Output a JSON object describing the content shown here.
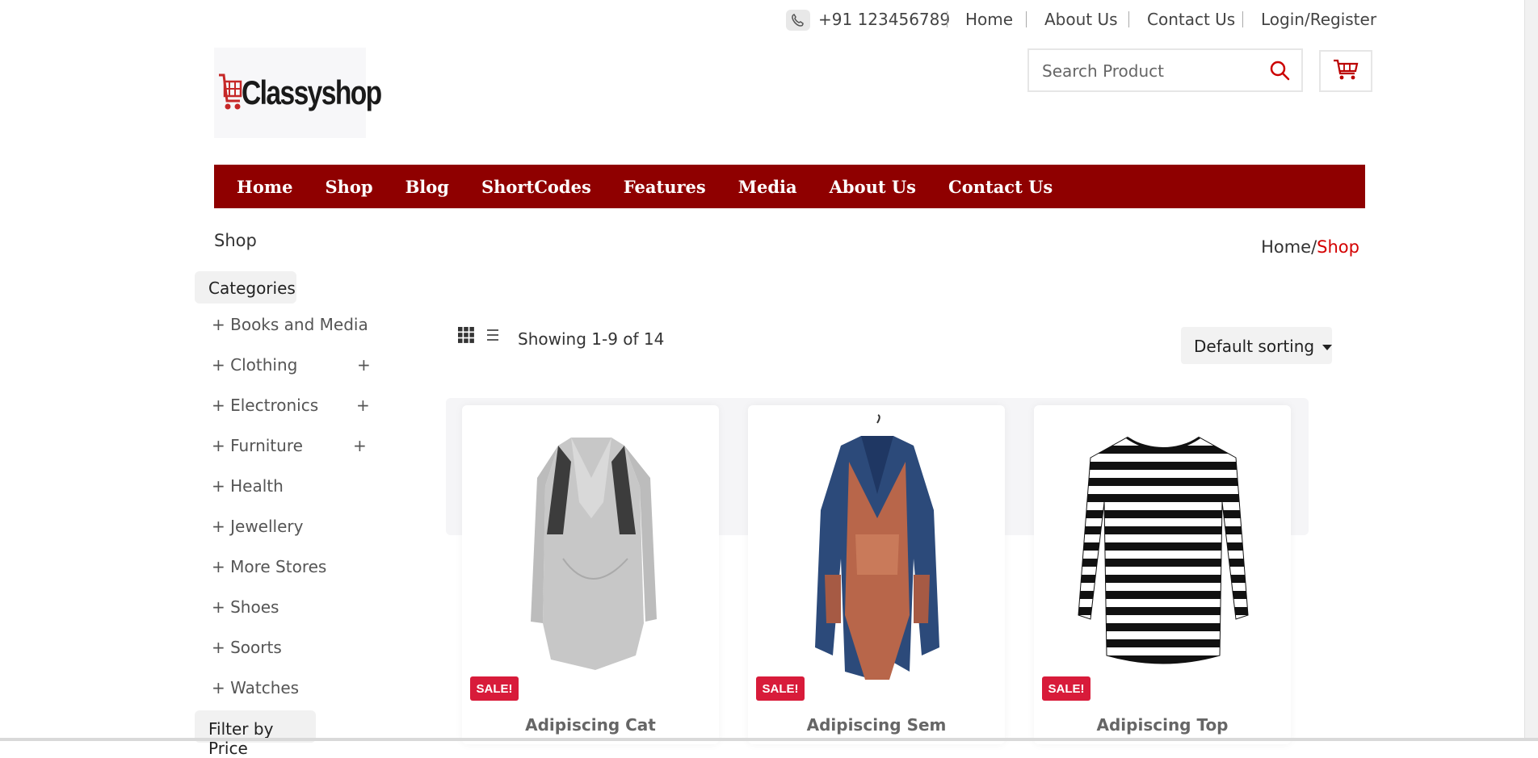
{
  "topbar": {
    "phone": "+91 123456789",
    "links": [
      "Home",
      "About Us",
      "Contact Us",
      "Login/Register"
    ]
  },
  "logo": {
    "text": "Classyshop"
  },
  "search": {
    "placeholder": "Search Product"
  },
  "nav": [
    "Home",
    "Shop",
    "Blog",
    "ShortCodes",
    "Features",
    "Media",
    "About Us",
    "Contact Us"
  ],
  "page": {
    "heading": "Shop",
    "breadcrumb": {
      "home": "Home/",
      "current": "Shop"
    }
  },
  "sidebar": {
    "categories_title": "Categories",
    "categories": [
      {
        "label": "+ Books and Media",
        "expand": ""
      },
      {
        "label": "+ Clothing",
        "expand": "+"
      },
      {
        "label": "+ Electronics",
        "expand": "+"
      },
      {
        "label": "+ Furniture",
        "expand": "+"
      },
      {
        "label": "+ Health",
        "expand": ""
      },
      {
        "label": "+ Jewellery",
        "expand": ""
      },
      {
        "label": "+ More Stores",
        "expand": ""
      },
      {
        "label": "+ Shoes",
        "expand": ""
      },
      {
        "label": "+ Soorts",
        "expand": ""
      },
      {
        "label": "+ Watches",
        "expand": ""
      }
    ],
    "price_title": "Filter by Price"
  },
  "toolbar": {
    "result_count": "Showing 1-9 of 14",
    "sort_selected": "Default sorting"
  },
  "products": [
    {
      "title": "Adipiscing Cat",
      "badge": "SALE!"
    },
    {
      "title": "Adipiscing Sem",
      "badge": "SALE!"
    },
    {
      "title": "Adipiscing Top",
      "badge": "SALE!"
    }
  ],
  "colors": {
    "brand_red": "#8f0000",
    "accent_red": "#d40000",
    "sale_badge": "#d81b3a"
  }
}
